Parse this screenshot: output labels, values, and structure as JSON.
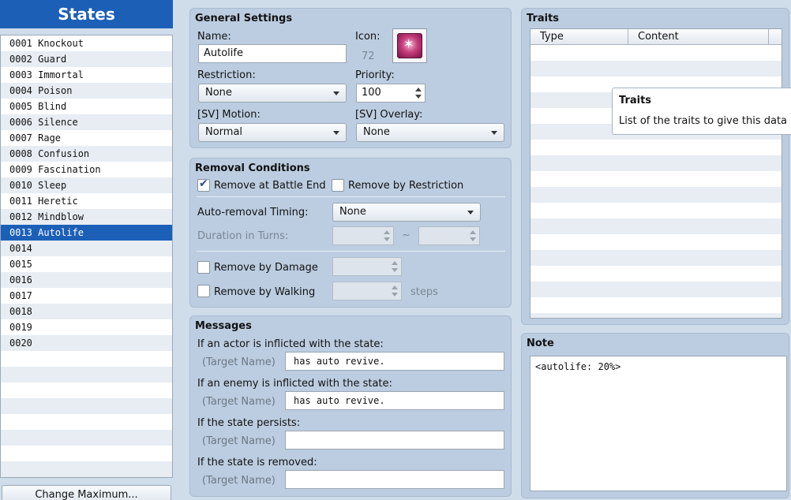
{
  "states_panel": {
    "title": "States",
    "items": [
      "0001 Knockout",
      "0002 Guard",
      "0003 Immortal",
      "0004 Poison",
      "0005 Blind",
      "0006 Silence",
      "0007 Rage",
      "0008 Confusion",
      "0009 Fascination",
      "0010 Sleep",
      "0011 Heretic",
      "0012 Mindblow",
      "0013 Autolife",
      "0014",
      "0015",
      "0016",
      "0017",
      "0018",
      "0019",
      "0020"
    ],
    "selected_index": 12,
    "change_max_label": "Change Maximum..."
  },
  "general": {
    "title": "General Settings",
    "name_label": "Name:",
    "name_value": "Autolife",
    "icon_label": "Icon:",
    "icon_index": "72",
    "restriction_label": "Restriction:",
    "restriction_value": "None",
    "priority_label": "Priority:",
    "priority_value": "100",
    "motion_label": "[SV] Motion:",
    "motion_value": "Normal",
    "overlay_label": "[SV] Overlay:",
    "overlay_value": "None"
  },
  "removal": {
    "title": "Removal Conditions",
    "battle_end_label": "Remove at Battle End",
    "battle_end_checked": true,
    "restriction_label": "Remove by Restriction",
    "restriction_checked": false,
    "timing_label": "Auto-removal Timing:",
    "timing_value": "None",
    "duration_label": "Duration in Turns:",
    "tilde": "~",
    "damage_label": "Remove by Damage",
    "walking_label": "Remove by Walking",
    "steps_label": "steps"
  },
  "messages": {
    "title": "Messages",
    "target_placeholder": "(Target Name)",
    "actor_label": "If an actor is inflicted with the state:",
    "actor_value": "has auto revive.",
    "enemy_label": "If an enemy is inflicted with the state:",
    "enemy_value": "has auto revive.",
    "persists_label": "If the state persists:",
    "persists_value": "",
    "removed_label": "If the state is removed:",
    "removed_value": ""
  },
  "traits": {
    "title": "Traits",
    "col_type": "Type",
    "col_content": "Content",
    "tooltip_title": "Traits",
    "tooltip_text": "List of the traits to give this data it"
  },
  "note": {
    "title": "Note",
    "value": "<autolife: 20%>"
  }
}
